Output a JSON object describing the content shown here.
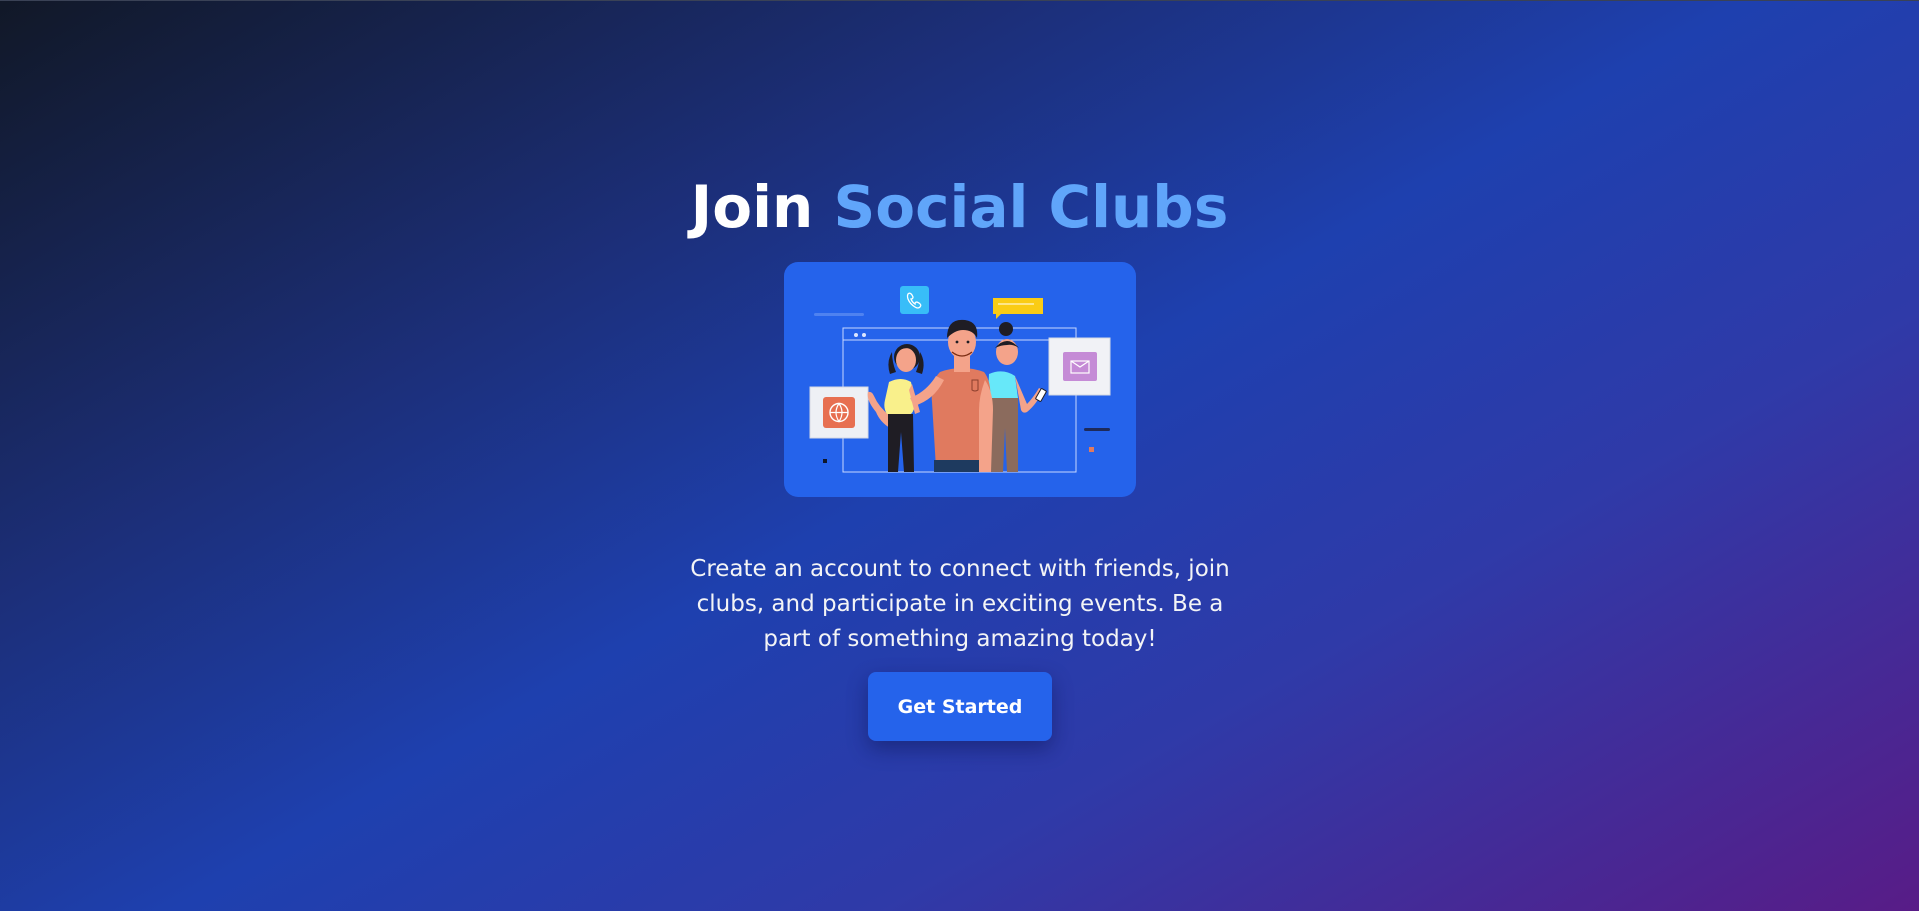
{
  "hero": {
    "title_plain": "Join",
    "title_accent": "Social Clubs",
    "description": "Create an account to connect with friends, join clubs, and participate in exciting events. Be a part of something amazing today!",
    "cta_label": "Get Started"
  },
  "colors": {
    "accent": "#60a5fa",
    "button": "#2563eb",
    "illustration_bg": "#2563eb",
    "background_start": "#111827",
    "background_end": "#581c87"
  },
  "icons": {
    "illustration": "people-social-illustration",
    "phone": "phone-icon",
    "chat": "chat-bubble-icon",
    "mail": "mail-icon",
    "globe": "globe-icon"
  }
}
